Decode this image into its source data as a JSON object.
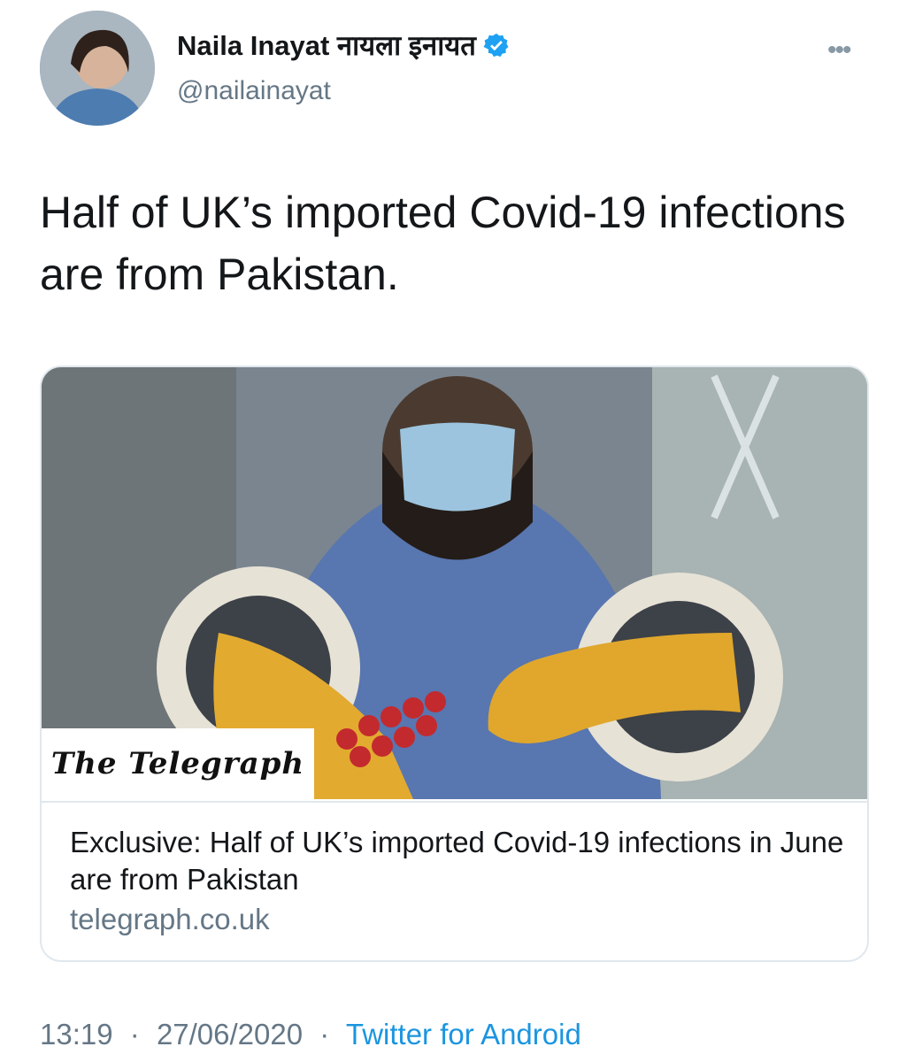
{
  "user": {
    "display_name": "Naila Inayat नायला इनायत",
    "handle": "@nailainayat",
    "verified_icon": "verified-badge-icon",
    "more_icon": "more-options-icon"
  },
  "tweet": {
    "text": "Half of UK’s imported Covid-19 infections are from Pakistan."
  },
  "card": {
    "brand_logo": "The Telegraph",
    "title": "Exclusive: Half of UK’s imported Covid-19 infections in June are from Pakistan",
    "domain": "telegraph.co.uk"
  },
  "meta": {
    "time": "13:19",
    "separator": "·",
    "date": "27/06/2020",
    "source": "Twitter for Android"
  },
  "colors": {
    "link": "#1b95e0",
    "muted": "#657786",
    "border": "#e1e8ed",
    "verified": "#1da1f2"
  }
}
